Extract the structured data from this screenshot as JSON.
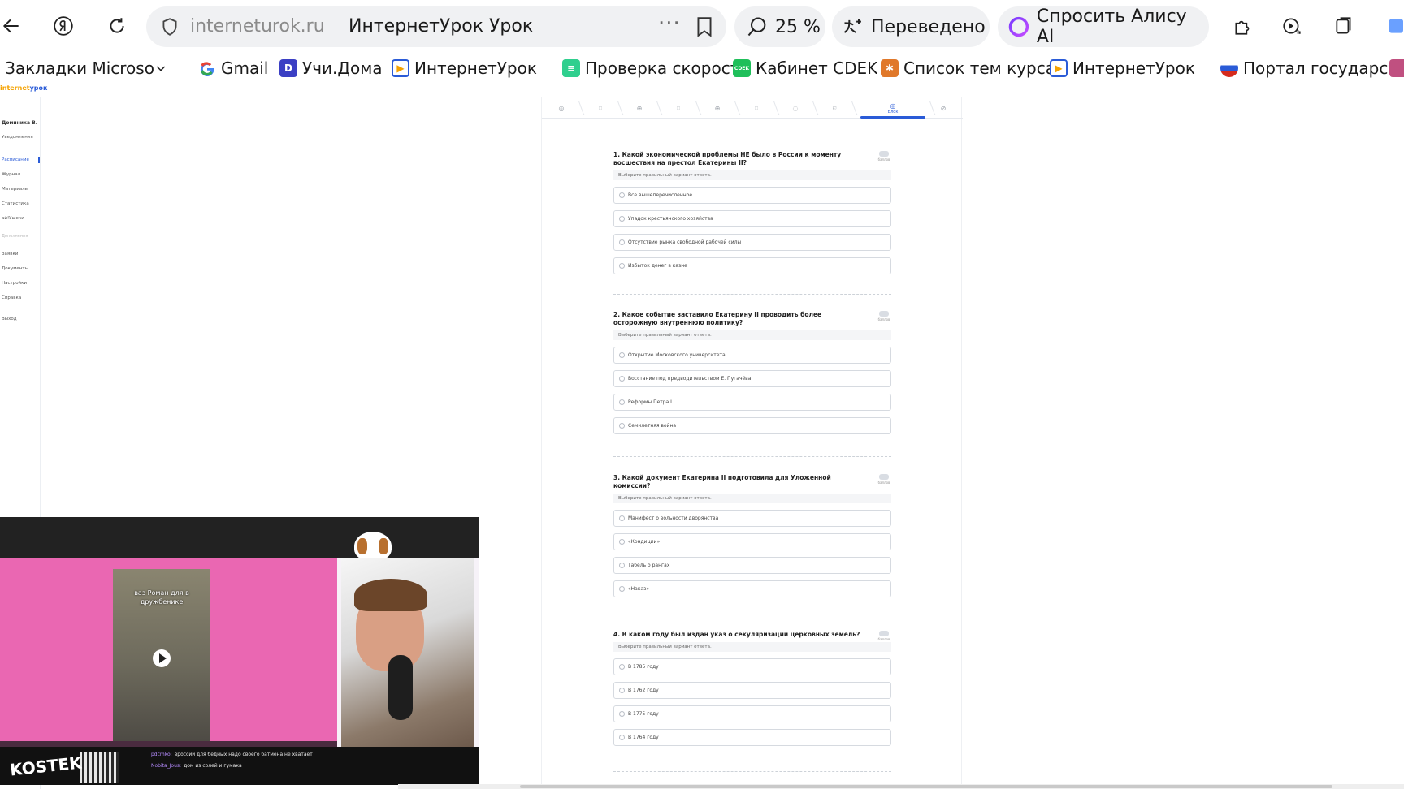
{
  "browser": {
    "address": {
      "domain": "interneturok.ru",
      "page_title": "ИнтернетУрок Урок",
      "more": "···"
    },
    "zoom": "25 %",
    "translated_label": "Переведено",
    "alice_label": "Спросить Алису AI"
  },
  "bookmarks": [
    {
      "label": "Закладки Microsoft E",
      "icon": "folder-icon",
      "color": "#666666"
    },
    {
      "label": "Gmail",
      "icon": "google-icon",
      "color": "#4285f4"
    },
    {
      "label": "Учи.Дома",
      "icon": "uchi-icon",
      "color": "#3b3fc4"
    },
    {
      "label": "ИнтернетУрок Ра",
      "icon": "play-icon",
      "color": "#2a5bd7"
    },
    {
      "label": "Проверка скорост",
      "icon": "speedtest-icon",
      "color": "#2fcf8e"
    },
    {
      "label": "Кабинет CDEK",
      "icon": "cdek-icon",
      "color": "#1fbf5a"
    },
    {
      "label": "Список тем курса",
      "icon": "course-icon",
      "color": "#e0782a"
    },
    {
      "label": "ИнтернетУрок Ра",
      "icon": "play-icon",
      "color": "#2a5bd7"
    },
    {
      "label": "Портал государст",
      "icon": "gosuslugi-icon",
      "color": "#d52b1e"
    }
  ],
  "site": {
    "logo_a": "internet",
    "logo_b": "урок",
    "user": "Доминика В.",
    "nav": [
      "Уведомления",
      "Расписание",
      "Журнал",
      "Материалы",
      "Статистика",
      "ай!Ушеки"
    ],
    "section": "Дополнения",
    "nav2": [
      "Заявки",
      "Документы",
      "Настройки",
      "Справка",
      "Выход"
    ]
  },
  "steps": {
    "active_label": "Блок"
  },
  "quiz": {
    "points_label": "баллов",
    "hint": "Выберите правильный вариант ответа.",
    "questions": [
      {
        "title": "1. Какой экономической проблемы НЕ было в России к моменту восшествия на престол Екатерины II?",
        "options": [
          "Все вышеперечисленное",
          "Упадок крестьянского хозяйства",
          "Отсутствие рынка свободной рабочей силы",
          "Избыток денег в казне"
        ]
      },
      {
        "title": "2. Какое событие заставило Екатерину II проводить более осторожную внутреннюю политику?",
        "options": [
          "Открытие Московского университета",
          "Восстание под предводительством Е. Пугачёва",
          "Реформы Петра I",
          "Семилетняя война"
        ]
      },
      {
        "title": "3. Какой документ Екатерина II подготовила для Уложенной комиссии?",
        "options": [
          "Манифест о вольности дворянства",
          "«Кондиции»",
          "Табель о рангах",
          "«Наказ»"
        ]
      },
      {
        "title": "4. В каком году был издан указ о секуляризации церковных земель?",
        "options": [
          "В 1785 году",
          "В 1762 году",
          "В 1775 году",
          "В 1764 году"
        ]
      }
    ]
  },
  "pip": {
    "caption": "ваз Роман для в дружбенике",
    "logo": "KOSTEK",
    "chat": [
      {
        "nick": "pdcmko:",
        "text": "вроссии для бедных надо своего батмена не хватает"
      },
      {
        "nick": "Nobita_Jous:",
        "text": "дом из солей и гумака"
      }
    ]
  }
}
